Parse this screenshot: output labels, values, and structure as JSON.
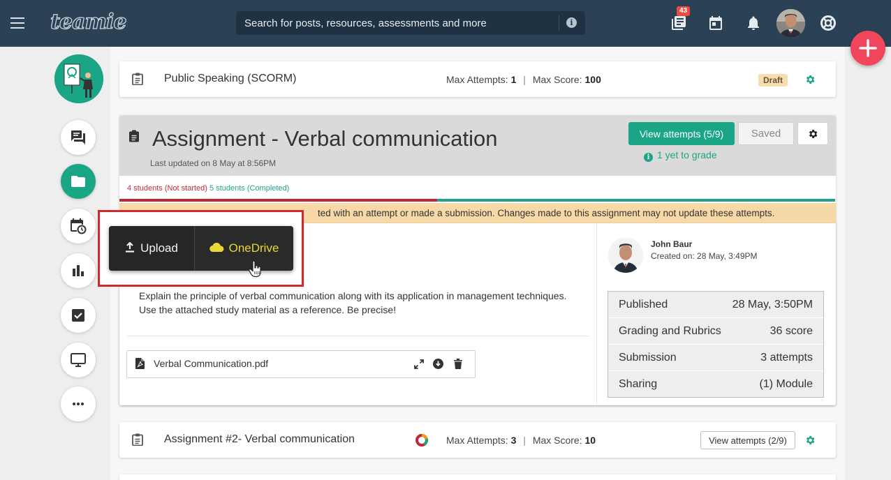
{
  "topbar": {
    "logo": "teamie",
    "search_placeholder": "Search for posts, resources, assessments and more",
    "notification_count": "43"
  },
  "items": [
    {
      "title": "Public Speaking (SCORM)",
      "max_attempts_label": "Max Attempts:",
      "max_attempts": "1",
      "max_score_label": "Max Score:",
      "max_score": "100",
      "status": "Draft"
    },
    {
      "title": "Assignment #2- Verbal communication",
      "max_attempts_label": "Max Attempts:",
      "max_attempts": "3",
      "max_score_label": "Max Score:",
      "max_score": "10",
      "view_attempts": "View attempts (2/9)"
    }
  ],
  "assignment": {
    "title": "Assignment - Verbal communication",
    "last_updated": "Last updated on 8 May at 8:56PM",
    "view_attempts": "View attempts (5/9)",
    "saved": "Saved",
    "to_grade": "1 yet to grade",
    "not_started": "4 students (Not started)",
    "completed": "5 students (Completed)",
    "progress_completed_fraction": 0.556,
    "warning": "ted with an attempt or made a submission. Changes made to this assignment may not update these attempts.",
    "description": "Explain the principle of verbal communication along with its application in management techniques. Use the attached study material as a reference. Be precise!",
    "attachment": "Verbal Communication.pdf",
    "author": {
      "name": "John Baur",
      "created": "Created on: 28 May, 3:49PM"
    },
    "info": [
      {
        "key": "Published",
        "value": "28 May, 3:50PM"
      },
      {
        "key": "Grading and Rubrics",
        "value": "36 score"
      },
      {
        "key": "Submission",
        "value": "3 attempts"
      },
      {
        "key": "Sharing",
        "value": "(1) Module"
      }
    ]
  },
  "upload_popover": {
    "upload": "Upload",
    "onedrive": "OneDrive"
  },
  "colors": {
    "topbar": "#2b4256",
    "accent": "#1aa586",
    "fab": "#f0455a",
    "warning_bg": "#f7d9a8",
    "highlight": "#cc2a2f"
  }
}
